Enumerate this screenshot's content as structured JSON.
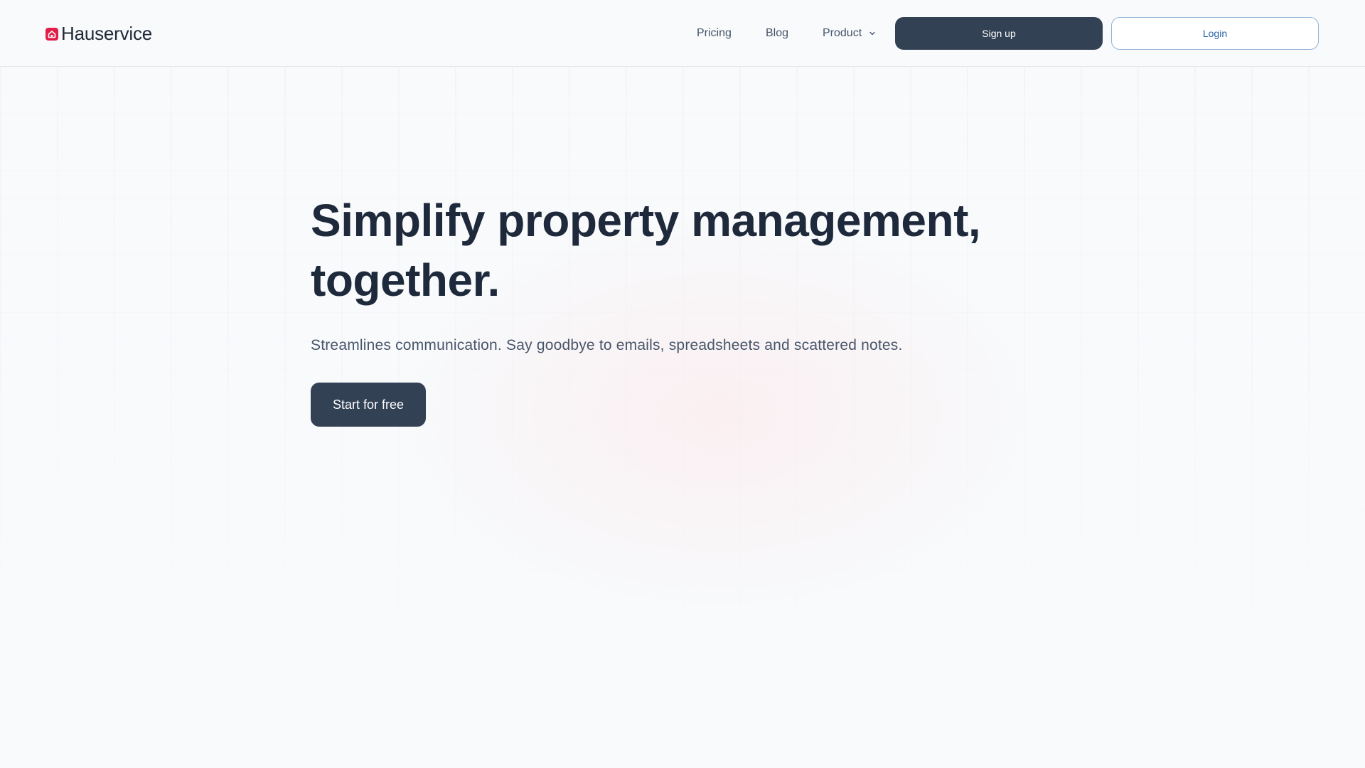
{
  "brand": {
    "name": "Hauservice",
    "logo_icon": "house-icon",
    "accent_color": "#e11d48"
  },
  "nav": {
    "pricing": "Pricing",
    "blog": "Blog",
    "product": "Product",
    "product_icon": "chevron-down-icon"
  },
  "header_actions": {
    "signup_label": "Sign up",
    "login_label": "Login"
  },
  "hero": {
    "title_line1": "Simplify property management,",
    "title_line2": "together.",
    "subtitle": "Streamlines communication. Say goodbye to emails, spreadsheets and scattered notes.",
    "cta_label": "Start for free"
  },
  "colors": {
    "primary_dark": "#334155",
    "heading": "#1e293b",
    "body_text": "#475569",
    "login_text": "#2563a8",
    "background": "#f8fafc"
  }
}
